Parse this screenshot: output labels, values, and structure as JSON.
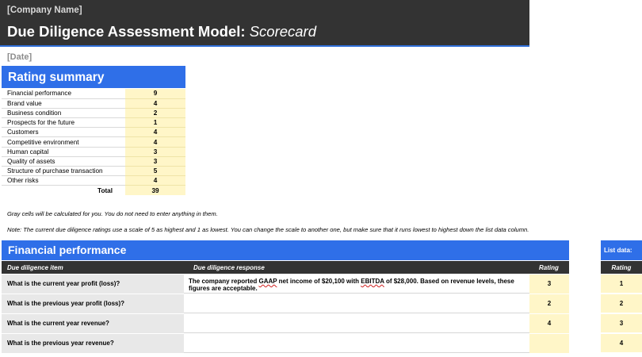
{
  "header": {
    "company": "[Company Name]",
    "title_main": "Due Diligence Assessment Model: ",
    "title_italic": "Scorecard"
  },
  "date": "[Date]",
  "rating_summary": {
    "title": "Rating summary",
    "rows": [
      {
        "label": "Financial performance",
        "value": "9"
      },
      {
        "label": "Brand value",
        "value": "4"
      },
      {
        "label": "Business condition",
        "value": "2"
      },
      {
        "label": "Prospects for the future",
        "value": "1"
      },
      {
        "label": "Customers",
        "value": "4"
      },
      {
        "label": "Competitive environment",
        "value": "4"
      },
      {
        "label": "Human capital",
        "value": "3"
      },
      {
        "label": "Quality of assets",
        "value": "3"
      },
      {
        "label": "Structure of purchase transaction",
        "value": "5"
      },
      {
        "label": "Other risks",
        "value": "4"
      }
    ],
    "total_label": "Total",
    "total_value": "39"
  },
  "notes": {
    "gray_cells": "Gray cells will be calculated for you. You do not need to enter anything in them.",
    "scale": "Note: The current due diligence ratings use a scale of 5 as highest and 1 as lowest. You can change the scale to another one, but make sure that it runs lowest to highest down the list data column."
  },
  "financial_performance": {
    "title": "Financial performance",
    "columns": {
      "item": "Due diligence item",
      "response": "Due diligence response",
      "rating": "Rating"
    },
    "rows": [
      {
        "item": "What is the current year profit (loss)?",
        "response_parts": [
          "The company reported ",
          "GAAP",
          " net income of $20,100 with ",
          "EBITDA",
          " of $28,000. Based on revenue levels, these figures are acceptable."
        ],
        "rating": "3"
      },
      {
        "item": "What is the previous year profit (loss)?",
        "response": "",
        "rating": "2"
      },
      {
        "item": "What is the current year revenue?",
        "response": "",
        "rating": "4"
      },
      {
        "item": "What is the previous year revenue?",
        "response": "",
        "rating": ""
      }
    ]
  },
  "list_data": {
    "title": "List data:",
    "column": "Rating",
    "values": [
      "1",
      "2",
      "3",
      "4"
    ]
  }
}
